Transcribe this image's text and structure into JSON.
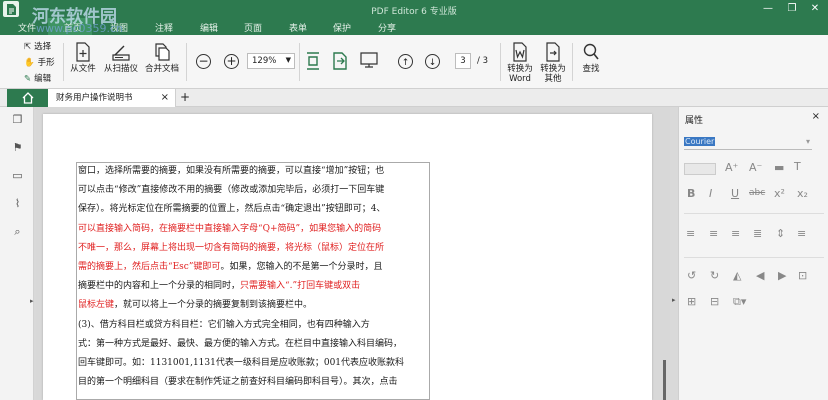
{
  "title_bar": {
    "app_title": "PDF Editor 6 专业版",
    "watermark_site": "河东软件园",
    "watermark_url": "www.pc0359.cn",
    "minimize": "—",
    "restore": "❐",
    "close": "✕"
  },
  "menu": [
    "文件",
    "首页",
    "视图",
    "注释",
    "编辑",
    "页面",
    "表单",
    "保护",
    "分享"
  ],
  "tools_left": [
    "选择",
    "手形",
    "编辑"
  ],
  "toolbar": {
    "from_file": "从文件",
    "from_scanner": "从扫描仪",
    "merge": "合并文档",
    "zoom": "129%",
    "page_current": "3",
    "page_total": "/ 3",
    "to_word_1": "转换为",
    "to_word_2": "Word",
    "to_other_1": "转换为",
    "to_other_2": "其他",
    "find": "查找"
  },
  "tab": {
    "doc_name": "财务用户操作说明书",
    "close": "×",
    "add": "+"
  },
  "right_panel": {
    "title": "属性",
    "close": "×",
    "font_name": "Courier",
    "font_arrow": "▾"
  },
  "document": {
    "lines": [
      {
        "segments": [
          {
            "t": "窗口，选择所需要的摘要，如果没有所需要的摘要，可以直接“增加”按钮；也",
            "red": false
          }
        ]
      },
      {
        "segments": [
          {
            "t": "可以点击“修改”直接修改不用的摘要（修改或添加完毕后，必须打一下回车键",
            "red": false
          }
        ]
      },
      {
        "segments": [
          {
            "t": "保存）。将光标定位在所需摘要的位置上，然后点击“确定退出”按钮即可；4、",
            "red": false
          }
        ]
      },
      {
        "segments": [
          {
            "t": "可以直接输入简码，在摘要栏中直接输入字母“Q+简码”，如果您输入的简码",
            "red": true
          }
        ]
      },
      {
        "segments": [
          {
            "t": "不唯一，那么，屏幕上将出现一切含有简码的摘要，将光标（鼠标）定位在所",
            "red": true
          }
        ]
      },
      {
        "segments": [
          {
            "t": "需的摘要上，然后点击“Esc”键即可",
            "red": true
          },
          {
            "t": "。如果，您输入的不是第一个分录时，且",
            "red": false
          }
        ]
      },
      {
        "segments": [
          {
            "t": "摘要栏中的内容和上一个分录的相同时，",
            "red": false
          },
          {
            "t": "只需要输入“.”打回车键或双击",
            "red": true
          }
        ]
      },
      {
        "segments": [
          {
            "t": "鼠标左键",
            "red": true
          },
          {
            "t": "，就可以将上一个分录的摘要复制到该摘要栏中。",
            "red": false
          }
        ]
      },
      {
        "segments": [
          {
            "t": "(3)、借方科目栏或贷方科目栏：它们输入方式完全相同，也有四种输入方",
            "red": false
          }
        ]
      },
      {
        "segments": [
          {
            "t": "式：第一种方式是最好、最快、最方便的输入方式。在栏目中直接输入科目编码，",
            "red": false
          }
        ]
      },
      {
        "segments": [
          {
            "t": "回车键即可。如：1131001,1131代表一级科目是应收账款；001代表应收账款科",
            "red": false
          }
        ]
      },
      {
        "segments": [
          {
            "t": "目的第一个明细科目（要求在制作凭证之前查好科目编码即科目号）。其次，点击",
            "red": false
          }
        ]
      }
    ]
  }
}
